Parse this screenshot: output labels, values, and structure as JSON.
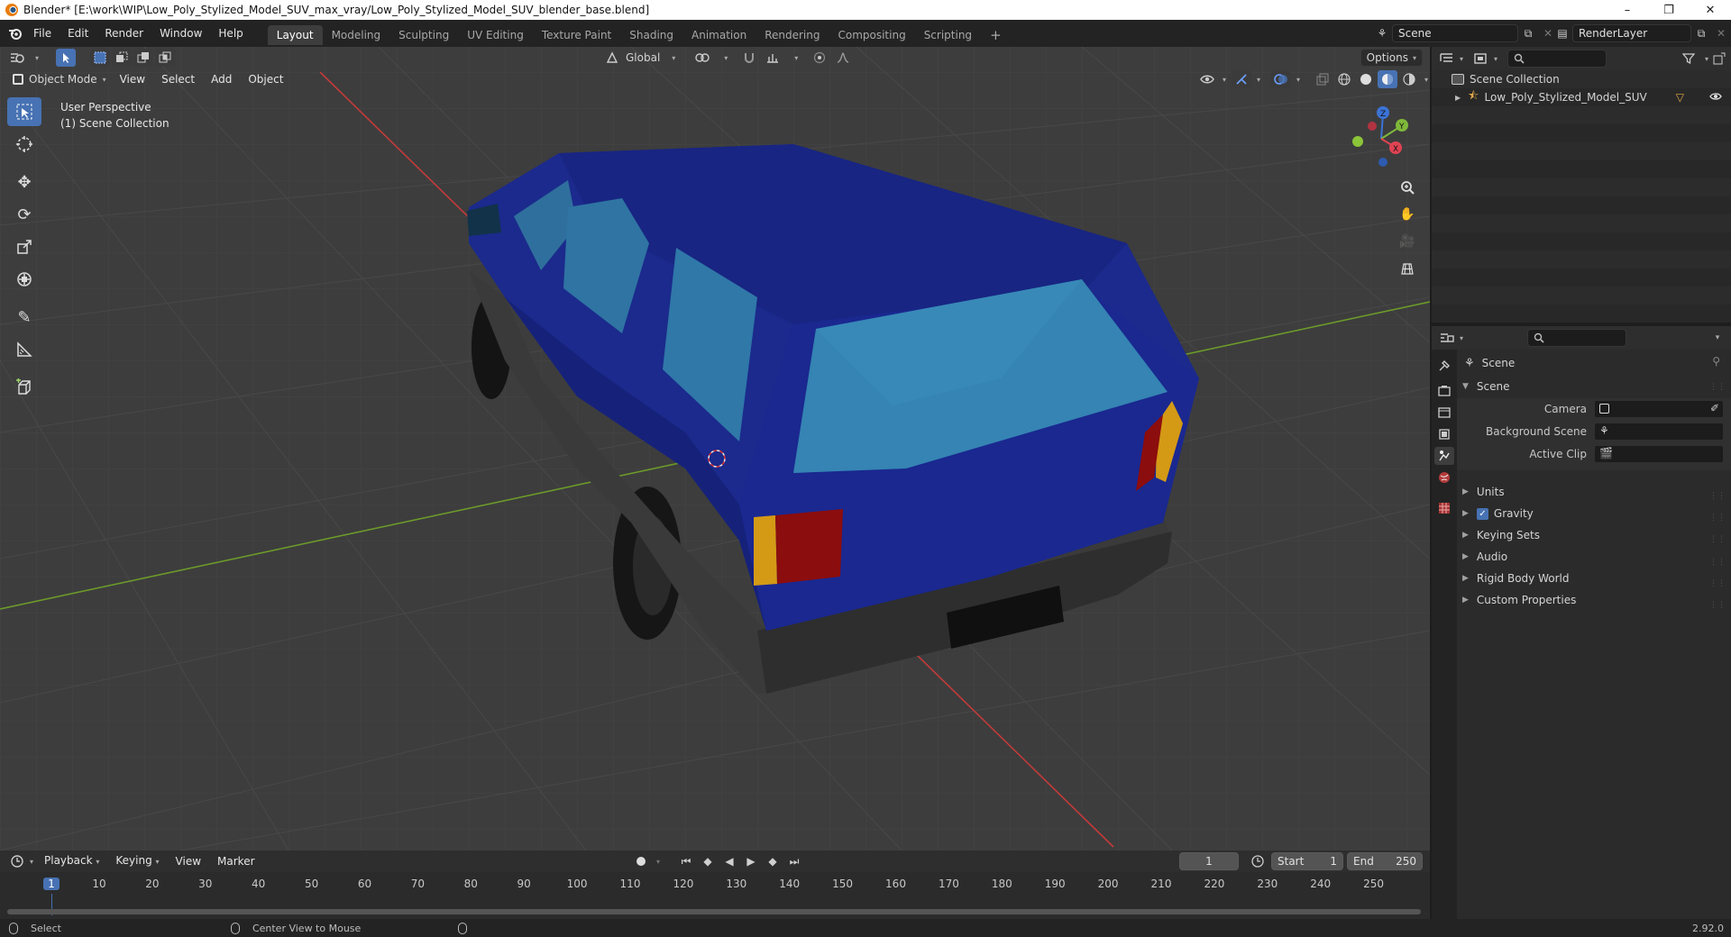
{
  "window": {
    "title": "Blender* [E:\\work\\WIP\\Low_Poly_Stylized_Model_SUV_max_vray/Low_Poly_Stylized_Model_SUV_blender_base.blend]",
    "minimize": "–",
    "maximize": "❐",
    "close": "✕"
  },
  "menubar": {
    "items": [
      "File",
      "Edit",
      "Render",
      "Window",
      "Help"
    ],
    "workspaces": [
      "Layout",
      "Modeling",
      "Sculpting",
      "UV Editing",
      "Texture Paint",
      "Shading",
      "Animation",
      "Rendering",
      "Compositing",
      "Scripting"
    ],
    "add_workspace": "+",
    "scene_name": "Scene",
    "view_layer": "RenderLayer"
  },
  "viewport_header": {
    "mode": "Object Mode",
    "menus": [
      "View",
      "Select",
      "Add",
      "Object"
    ],
    "transform_orientation": "Global",
    "options": "Options"
  },
  "viewport": {
    "perspective_label": "User Perspective",
    "collection_label": "(1) Scene Collection",
    "gizmo": {
      "z": "Z",
      "y": "Y",
      "x": "X"
    }
  },
  "outliner": {
    "root": "Scene Collection",
    "items": [
      {
        "label": "Low_Poly_Stylized_Model_SUV"
      }
    ]
  },
  "properties": {
    "context": "Scene",
    "section_title": "Scene",
    "fields": [
      {
        "label": "Camera"
      },
      {
        "label": "Background Scene"
      },
      {
        "label": "Active Clip"
      }
    ],
    "panels": [
      {
        "label": "Units",
        "checkbox": false
      },
      {
        "label": "Gravity",
        "checkbox": true
      },
      {
        "label": "Keying Sets",
        "checkbox": false
      },
      {
        "label": "Audio",
        "checkbox": false
      },
      {
        "label": "Rigid Body World",
        "checkbox": false
      },
      {
        "label": "Custom Properties",
        "checkbox": false
      }
    ]
  },
  "timeline": {
    "menus": [
      "Playback",
      "Keying",
      "View",
      "Marker"
    ],
    "current_frame": "1",
    "start_label": "Start",
    "start_value": "1",
    "end_label": "End",
    "end_value": "250",
    "ruler": [
      "1",
      "10",
      "20",
      "30",
      "40",
      "50",
      "60",
      "70",
      "80",
      "90",
      "100",
      "110",
      "120",
      "130",
      "140",
      "150",
      "160",
      "170",
      "180",
      "190",
      "200",
      "210",
      "220",
      "230",
      "240",
      "250"
    ]
  },
  "statusbar": {
    "left": "Select",
    "middle": "Center View to Mouse",
    "version": "2.92.0"
  },
  "colors": {
    "accent": "#4772b3",
    "car_body": "#1b2a8c",
    "window_glass": "#2f7aa6",
    "grid_x_axis": "#c43a3a",
    "grid_y_axis": "#6c9a2a"
  }
}
